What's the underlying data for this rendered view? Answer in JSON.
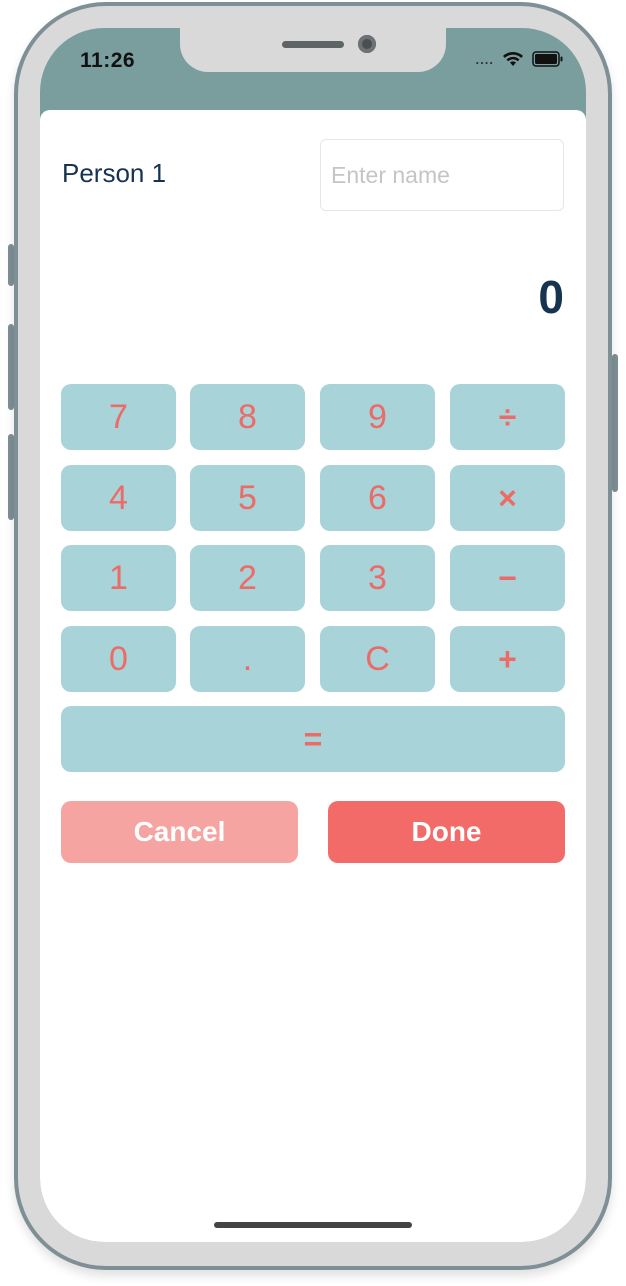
{
  "status_bar": {
    "time": "11:26",
    "signal": "....",
    "wifi_icon": "wifi-icon",
    "battery_icon": "battery-icon"
  },
  "form": {
    "person_label": "Person 1",
    "name_placeholder": "Enter name",
    "name_value": ""
  },
  "calculator": {
    "display": "0",
    "keys": [
      [
        "7",
        "8",
        "9",
        "÷"
      ],
      [
        "4",
        "5",
        "6",
        "×"
      ],
      [
        "1",
        "2",
        "3",
        "−"
      ],
      [
        "0",
        ".",
        "C",
        "+"
      ]
    ],
    "equals": "="
  },
  "actions": {
    "cancel_label": "Cancel",
    "done_label": "Done"
  },
  "colors": {
    "key_bg": "#a8d3d9",
    "key_text": "#ec6b66",
    "cancel_bg": "#f5a4a2",
    "done_bg": "#f26b68",
    "title_text": "#163350",
    "header_bg": "#7a9e9e"
  }
}
